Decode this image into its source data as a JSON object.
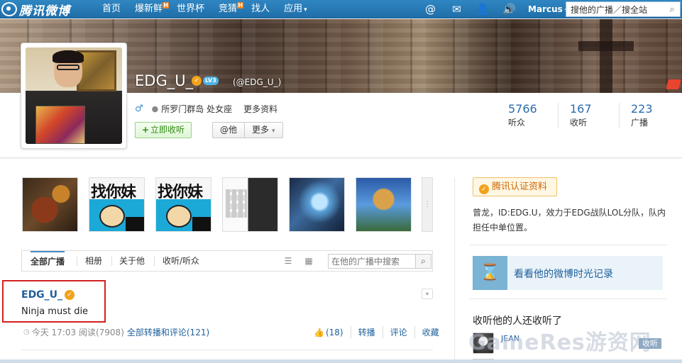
{
  "topnav": {
    "logo_text": "腾讯微博",
    "items": [
      {
        "label": "首页",
        "hot": ""
      },
      {
        "label": "爆新鲜",
        "hot": "H"
      },
      {
        "label": "世界杯",
        "hot": ""
      },
      {
        "label": "竞猜",
        "hot": "H"
      },
      {
        "label": "找人",
        "hot": ""
      },
      {
        "label": "应用",
        "hot": ""
      }
    ],
    "icons": [
      "at-icon",
      "mail-icon",
      "user-icon",
      "sound-icon"
    ],
    "icon_glyphs": {
      "at": "@",
      "mail": "✉",
      "user": "👤",
      "sound": "🔊"
    },
    "username": "Marcus",
    "search_value": "搜他的广播／搜全站",
    "search_glyph": "⌕",
    "caret": "▾"
  },
  "profile": {
    "name": "EDG_U_",
    "verified_glyph": "✓",
    "level": "LV3",
    "handle": "(@EDG_U_)",
    "gender_glyph": "♂",
    "location": "所罗门群岛 处女座",
    "more_info": "更多资料",
    "follow_label": "立即收听",
    "follow_plus": "+",
    "mention_label": "@他",
    "more_label": "更多",
    "stats": [
      {
        "num": "5766",
        "label": "听众"
      },
      {
        "num": "167",
        "label": "收听"
      },
      {
        "num": "223",
        "label": "广播"
      }
    ]
  },
  "thumbs": {
    "text2": "找你妹",
    "text3": "找你妹",
    "more_glyph": "⋮"
  },
  "tabs": {
    "items": [
      "全部广播",
      "相册",
      "关于他",
      "收听/听众"
    ],
    "list_glyph": "☰",
    "calendar_glyph": "▦",
    "search_placeholder": "在他的广播中搜索",
    "search_glyph": "⌕"
  },
  "post": {
    "author": "EDG_U_",
    "text": "Ninja must die",
    "clock_glyph": "◷",
    "time": "今天 17:03",
    "reads": "阅读(7908)",
    "comments_link": "全部转播和评论(121)",
    "like_glyph": "👍",
    "likes": "(18)",
    "actions": [
      "转播",
      "评论",
      "收藏"
    ],
    "dropdown_glyph": "▾"
  },
  "sidebar": {
    "verify_label": "腾讯认证资料",
    "bio": "曾龙，ID:EDG.U，效力于EDG战队LOL分队，队内担任中单位置。",
    "timeline_label": "看看他的微博时光记录",
    "hourglass_glyph": "⌛",
    "listen_title": "收听他的人还收听了",
    "listener_name": "JEAN",
    "listen_tag": "收听"
  },
  "watermark": "GameRes游资网"
}
